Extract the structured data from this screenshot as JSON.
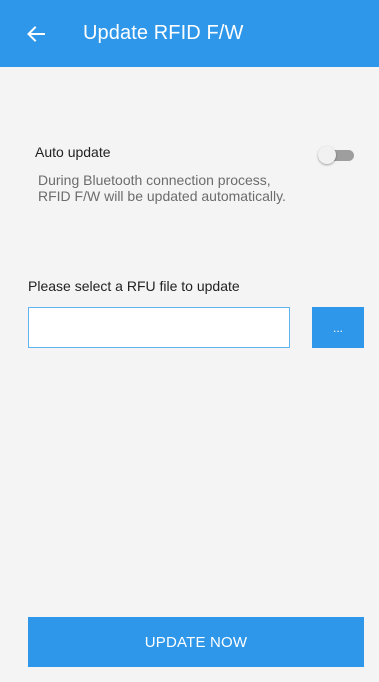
{
  "app_bar": {
    "title": "Update RFID F/W",
    "back_icon": "arrow-left-icon",
    "color": "#2e97ea"
  },
  "auto_update": {
    "label": "Auto update",
    "description": "During Bluetooth connection process, RFID F/W will be updated automatically.",
    "enabled": false
  },
  "file_select": {
    "label": "Please select a RFU file to update",
    "value": "",
    "browse_label": "..."
  },
  "actions": {
    "update_label": "UPDATE NOW"
  },
  "colors": {
    "accent": "#2e97ea",
    "background": "#f4f4f4"
  }
}
